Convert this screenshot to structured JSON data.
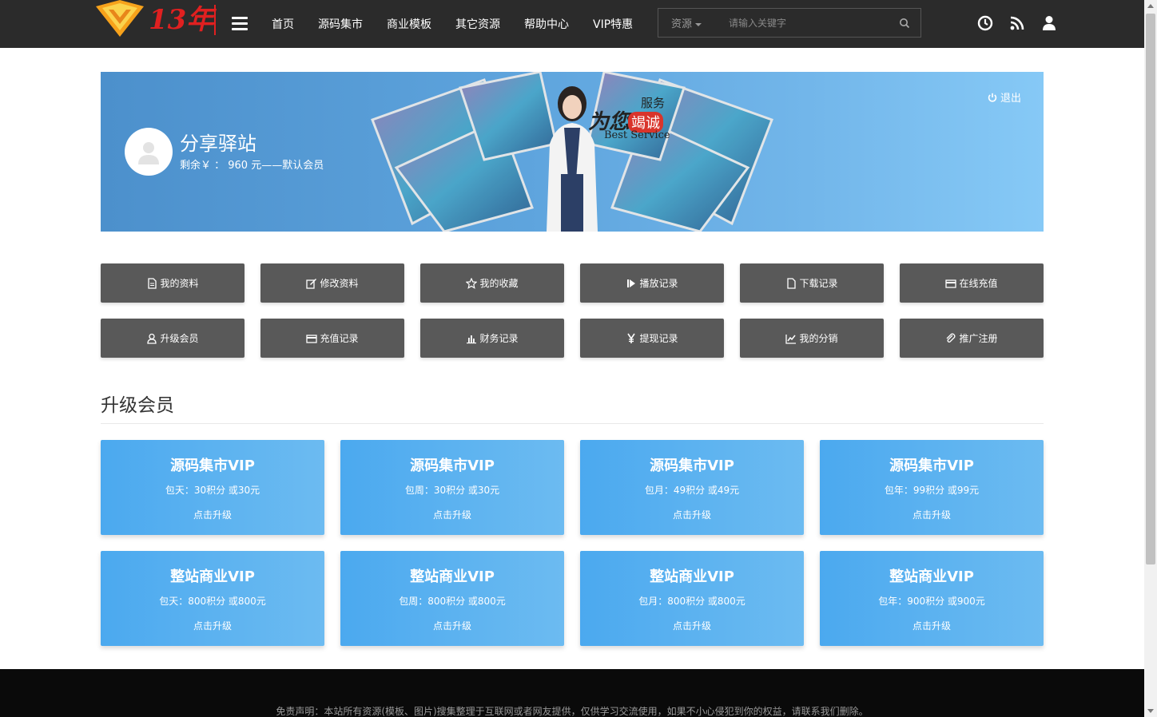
{
  "brand": {
    "logo_text": "13年",
    "accent": "#f7a21b",
    "logo_red": "#e02020"
  },
  "nav": {
    "items": [
      "首页",
      "源码集市",
      "商业模板",
      "其它资源",
      "帮助中心",
      "VIP特惠"
    ]
  },
  "search": {
    "category": "资源",
    "placeholder": "请输入关键字"
  },
  "top_icons": [
    "clock-icon",
    "rss-icon",
    "user-icon"
  ],
  "profile": {
    "name": "分享驿站",
    "balance_line": "剩余￥ ： 960 元——默认会员",
    "logout": "退出",
    "slogan": {
      "line1": "服务",
      "line2": "为您",
      "line3": "竭诚",
      "line4": "Best Service"
    }
  },
  "actions": [
    {
      "label": "我的资料",
      "icon": "document-icon"
    },
    {
      "label": "修改资料",
      "icon": "edit-icon"
    },
    {
      "label": "我的收藏",
      "icon": "star-icon"
    },
    {
      "label": "播放记录",
      "icon": "play-icon"
    },
    {
      "label": "下载记录",
      "icon": "file-icon"
    },
    {
      "label": "在线充值",
      "icon": "card-icon"
    },
    {
      "label": "升级会员",
      "icon": "user-outline-icon"
    },
    {
      "label": "充值记录",
      "icon": "card-icon"
    },
    {
      "label": "财务记录",
      "icon": "bar-chart-icon"
    },
    {
      "label": "提现记录",
      "icon": "yen-icon"
    },
    {
      "label": "我的分销",
      "icon": "line-chart-icon"
    },
    {
      "label": "推广注册",
      "icon": "paperclip-icon"
    }
  ],
  "section": {
    "title": "升级会员"
  },
  "vip_cards": [
    {
      "title": "源码集市VIP",
      "price": "包天：30积分 或30元",
      "button": "点击升级"
    },
    {
      "title": "源码集市VIP",
      "price": "包周：30积分 或30元",
      "button": "点击升级"
    },
    {
      "title": "源码集市VIP",
      "price": "包月：49积分 或49元",
      "button": "点击升级"
    },
    {
      "title": "源码集市VIP",
      "price": "包年：99积分 或99元",
      "button": "点击升级"
    },
    {
      "title": "整站商业VIP",
      "price": "包天：800积分 或800元",
      "button": "点击升级"
    },
    {
      "title": "整站商业VIP",
      "price": "包周：800积分 或800元",
      "button": "点击升级"
    },
    {
      "title": "整站商业VIP",
      "price": "包月：800积分 或800元",
      "button": "点击升级"
    },
    {
      "title": "整站商业VIP",
      "price": "包年：900积分 或900元",
      "button": "点击升级"
    }
  ],
  "footer": {
    "disclaimer": "免责声明：本站所有资源(模板、图片)搜集整理于互联网或者网友提供，仅供学习交流使用，如果不小心侵犯到你的权益，请联系我们删除。"
  }
}
